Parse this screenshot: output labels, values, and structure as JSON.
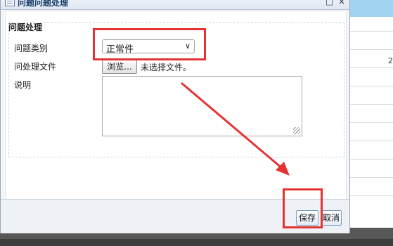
{
  "dialog": {
    "title": "问题问题处理",
    "close_glyph": "×"
  },
  "form": {
    "group_title": "问题处理",
    "category_label": "问题类别",
    "category_value": "正常件",
    "file_label": "问处理文件",
    "browse_button": "浏览...",
    "file_status": "未选择文件。",
    "description_label": "说明",
    "description_value": ""
  },
  "footer": {
    "save_label": "保存",
    "cancel_label": "取消"
  },
  "background": {
    "cell_value": "2"
  },
  "colors": {
    "annotation": "#e53333",
    "header_blue": "#9fd3ef"
  }
}
